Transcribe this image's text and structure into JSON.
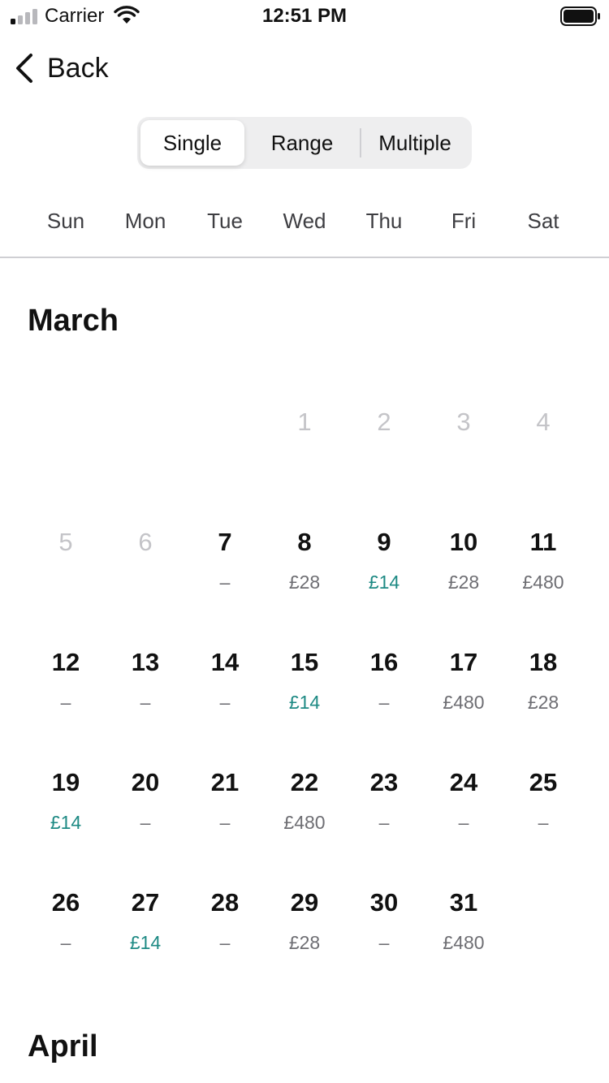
{
  "status_bar": {
    "carrier": "Carrier",
    "time": "12:51 PM"
  },
  "nav": {
    "back_label": "Back"
  },
  "segmented": {
    "options": [
      "Single",
      "Range",
      "Multiple"
    ],
    "selected": "Single"
  },
  "colors": {
    "cheap_price": "#1e8a84",
    "regular_price": "#6e6e73",
    "disabled_day": "#c4c4c8"
  },
  "weekdays": [
    "Sun",
    "Mon",
    "Tue",
    "Wed",
    "Thu",
    "Fri",
    "Sat"
  ],
  "months": [
    {
      "name": "March",
      "weeks": [
        [
          null,
          null,
          null,
          {
            "day": "1",
            "disabled": true
          },
          {
            "day": "2",
            "disabled": true
          },
          {
            "day": "3",
            "disabled": true
          },
          {
            "day": "4",
            "disabled": true
          }
        ],
        [
          {
            "day": "5",
            "disabled": true
          },
          {
            "day": "6",
            "disabled": true
          },
          {
            "day": "7",
            "price": "–"
          },
          {
            "day": "8",
            "price": "£28"
          },
          {
            "day": "9",
            "price": "£14",
            "cheap": true
          },
          {
            "day": "10",
            "price": "£28"
          },
          {
            "day": "11",
            "price": "£480"
          }
        ],
        [
          {
            "day": "12",
            "price": "–"
          },
          {
            "day": "13",
            "price": "–"
          },
          {
            "day": "14",
            "price": "–"
          },
          {
            "day": "15",
            "price": "£14",
            "cheap": true
          },
          {
            "day": "16",
            "price": "–"
          },
          {
            "day": "17",
            "price": "£480"
          },
          {
            "day": "18",
            "price": "£28"
          }
        ],
        [
          {
            "day": "19",
            "price": "£14",
            "cheap": true
          },
          {
            "day": "20",
            "price": "–"
          },
          {
            "day": "21",
            "price": "–"
          },
          {
            "day": "22",
            "price": "£480"
          },
          {
            "day": "23",
            "price": "–"
          },
          {
            "day": "24",
            "price": "–"
          },
          {
            "day": "25",
            "price": "–"
          }
        ],
        [
          {
            "day": "26",
            "price": "–"
          },
          {
            "day": "27",
            "price": "£14",
            "cheap": true
          },
          {
            "day": "28",
            "price": "–"
          },
          {
            "day": "29",
            "price": "£28"
          },
          {
            "day": "30",
            "price": "–"
          },
          {
            "day": "31",
            "price": "£480"
          },
          null
        ]
      ]
    },
    {
      "name": "April",
      "weeks": []
    }
  ]
}
